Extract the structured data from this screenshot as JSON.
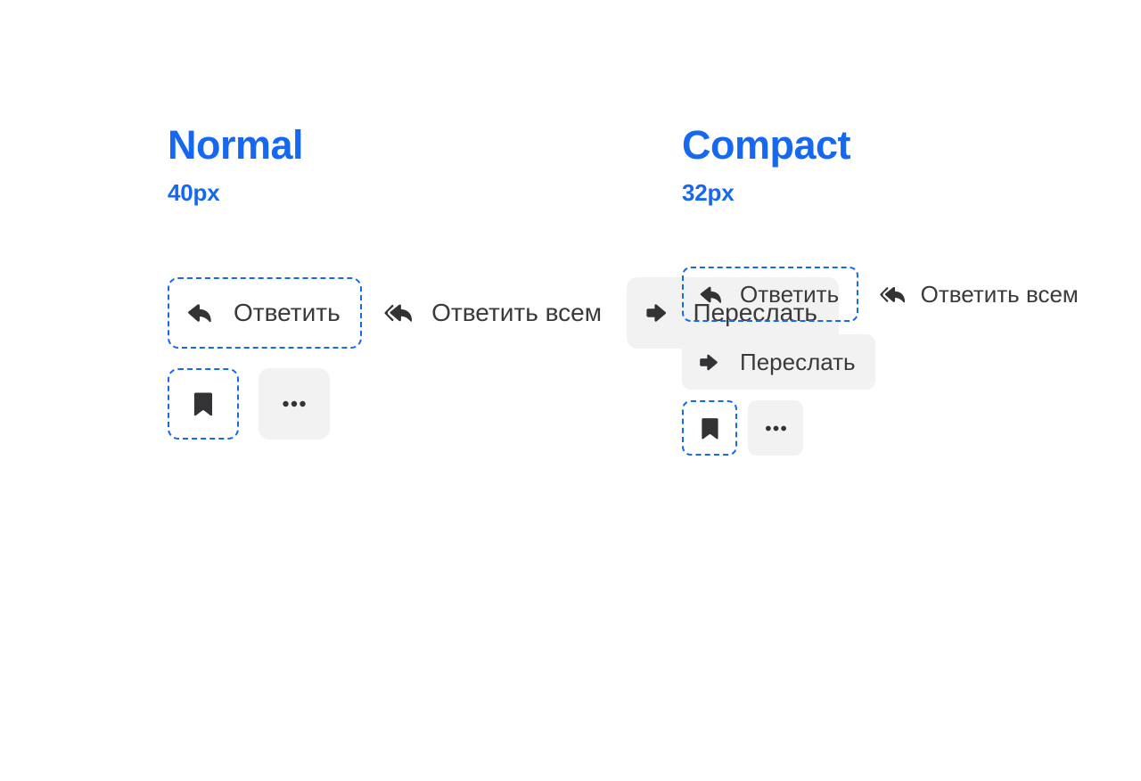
{
  "page": {
    "background": "#FFFFFF",
    "accent_blue": "#1668F0",
    "surface_gray": "#F2F2F3",
    "icon_color": "#333335",
    "label_color": "#3A3A3C"
  },
  "columns": [
    {
      "key": "normal",
      "heading": "Normal",
      "subheading": "40px",
      "buttons": [
        {
          "name": "reply",
          "label": "Ответить",
          "icon": "reply-icon",
          "state": "focused"
        },
        {
          "name": "reply-all",
          "label": "Ответить всем",
          "icon": "reply-all-icon",
          "state": "plain"
        },
        {
          "name": "forward",
          "label": "Переслать",
          "icon": "forward-icon",
          "state": "filled"
        }
      ],
      "icon_buttons": [
        {
          "name": "bookmark",
          "icon": "bookmark-icon",
          "state": "focused"
        },
        {
          "name": "more",
          "icon": "more-dots-icon",
          "state": "filled"
        }
      ]
    },
    {
      "key": "compact",
      "heading": "Compact",
      "subheading": "32px",
      "buttons": [
        {
          "name": "reply",
          "label": "Ответить",
          "icon": "reply-icon",
          "state": "focused"
        },
        {
          "name": "reply-all",
          "label": "Ответить всем",
          "icon": "reply-all-icon",
          "state": "plain"
        },
        {
          "name": "forward",
          "label": "Переслать",
          "icon": "forward-icon",
          "state": "filled"
        }
      ],
      "icon_buttons": [
        {
          "name": "bookmark",
          "icon": "bookmark-icon",
          "state": "focused"
        },
        {
          "name": "more",
          "icon": "more-dots-icon",
          "state": "filled"
        }
      ]
    }
  ]
}
